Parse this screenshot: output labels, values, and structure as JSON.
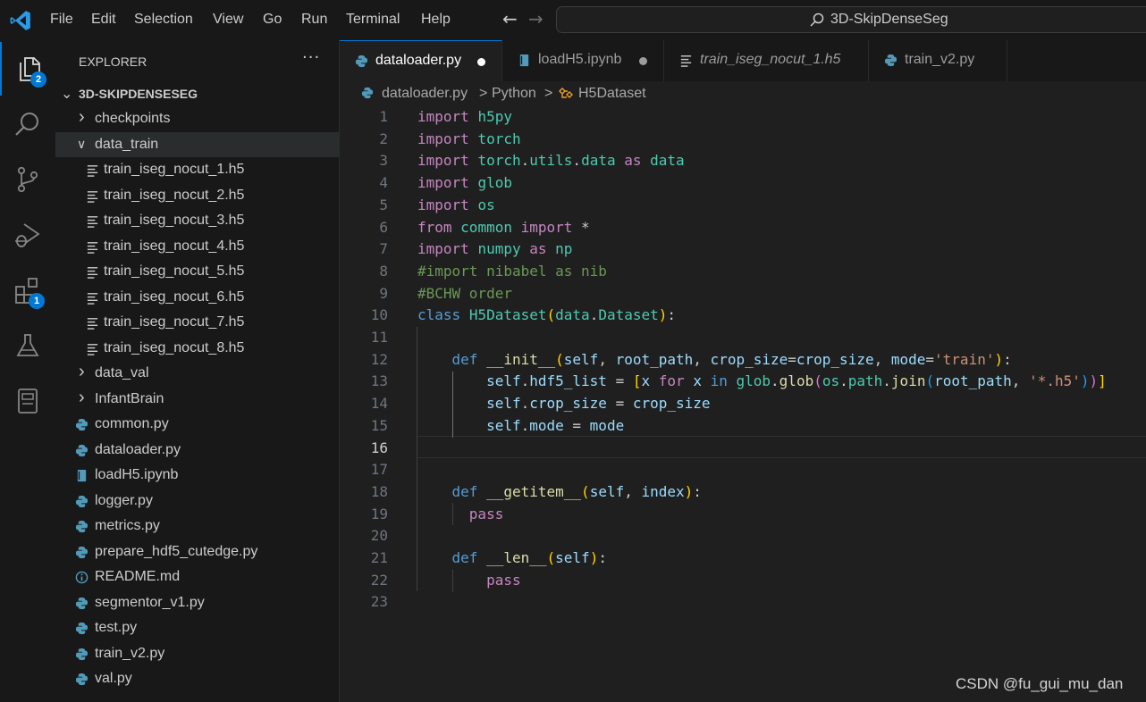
{
  "titlebar": {
    "menu": [
      "File",
      "Edit",
      "Selection",
      "View",
      "Go",
      "Run",
      "Terminal",
      "Help"
    ],
    "command_center": "3D-SkipDenseSeg"
  },
  "activity_bar": {
    "explorer_badge": "2",
    "extensions_badge": "1"
  },
  "sidebar": {
    "title": "EXPLORER",
    "more": "···",
    "workspace": "3D-SKIPDENSESEG",
    "tree": [
      {
        "label": "checkpoints",
        "kind": "folder",
        "expanded": false
      },
      {
        "label": "data_train",
        "kind": "folder",
        "expanded": true
      },
      {
        "label": "train_iseg_nocut_1.h5",
        "kind": "file-text"
      },
      {
        "label": "train_iseg_nocut_2.h5",
        "kind": "file-text"
      },
      {
        "label": "train_iseg_nocut_3.h5",
        "kind": "file-text"
      },
      {
        "label": "train_iseg_nocut_4.h5",
        "kind": "file-text"
      },
      {
        "label": "train_iseg_nocut_5.h5",
        "kind": "file-text"
      },
      {
        "label": "train_iseg_nocut_6.h5",
        "kind": "file-text"
      },
      {
        "label": "train_iseg_nocut_7.h5",
        "kind": "file-text"
      },
      {
        "label": "train_iseg_nocut_8.h5",
        "kind": "file-text"
      },
      {
        "label": "data_val",
        "kind": "folder",
        "expanded": false
      },
      {
        "label": "InfantBrain",
        "kind": "folder",
        "expanded": false
      },
      {
        "label": "common.py",
        "kind": "python"
      },
      {
        "label": "dataloader.py",
        "kind": "python"
      },
      {
        "label": "loadH5.ipynb",
        "kind": "notebook"
      },
      {
        "label": "logger.py",
        "kind": "python"
      },
      {
        "label": "metrics.py",
        "kind": "python"
      },
      {
        "label": "prepare_hdf5_cutedge.py",
        "kind": "python"
      },
      {
        "label": "README.md",
        "kind": "info"
      },
      {
        "label": "segmentor_v1.py",
        "kind": "python"
      },
      {
        "label": "test.py",
        "kind": "python"
      },
      {
        "label": "train_v2.py",
        "kind": "python"
      },
      {
        "label": "val.py",
        "kind": "python"
      }
    ]
  },
  "tabs": [
    {
      "label": "dataloader.py",
      "icon": "python",
      "active": true,
      "dirty": true
    },
    {
      "label": "loadH5.ipynb",
      "icon": "notebook",
      "active": false,
      "dirty": true
    },
    {
      "label": "train_iseg_nocut_1.h5",
      "icon": "file-text",
      "active": false,
      "dirty": false,
      "italic": true
    },
    {
      "label": "train_v2.py",
      "icon": "python",
      "active": false,
      "dirty": false
    }
  ],
  "breadcrumb": {
    "file": "dataloader.py",
    "sep1": ">",
    "language": "Python",
    "sep2": ">",
    "symbol": "H5Dataset"
  },
  "editor": {
    "current_line": 16,
    "lines": [
      [
        [
          "kw",
          "import"
        ],
        [
          "",
          " "
        ],
        [
          "mod",
          "h5py"
        ]
      ],
      [
        [
          "kw",
          "import"
        ],
        [
          "",
          " "
        ],
        [
          "mod",
          "torch"
        ]
      ],
      [
        [
          "kw",
          "import"
        ],
        [
          "",
          " "
        ],
        [
          "mod",
          "torch"
        ],
        [
          "",
          "."
        ],
        [
          "mod",
          "utils"
        ],
        [
          "",
          "."
        ],
        [
          "mod",
          "data"
        ],
        [
          "",
          " "
        ],
        [
          "kw",
          "as"
        ],
        [
          "",
          " "
        ],
        [
          "mod",
          "data"
        ]
      ],
      [
        [
          "kw",
          "import"
        ],
        [
          "",
          " "
        ],
        [
          "mod",
          "glob"
        ]
      ],
      [
        [
          "kw",
          "import"
        ],
        [
          "",
          " "
        ],
        [
          "mod",
          "os"
        ]
      ],
      [
        [
          "kw",
          "from"
        ],
        [
          "",
          " "
        ],
        [
          "mod",
          "common"
        ],
        [
          "",
          " "
        ],
        [
          "kw",
          "import"
        ],
        [
          "",
          " *"
        ]
      ],
      [
        [
          "kw",
          "import"
        ],
        [
          "",
          " "
        ],
        [
          "mod",
          "numpy"
        ],
        [
          "",
          " "
        ],
        [
          "kw",
          "as"
        ],
        [
          "",
          " "
        ],
        [
          "mod",
          "np"
        ]
      ],
      [
        [
          "com",
          "#import nibabel as nib"
        ]
      ],
      [
        [
          "com",
          "#BCHW order"
        ]
      ],
      [
        [
          "kw2",
          "class"
        ],
        [
          "",
          " "
        ],
        [
          "mod",
          "H5Dataset"
        ],
        [
          "br1",
          "("
        ],
        [
          "mod",
          "data"
        ],
        [
          "",
          "."
        ],
        [
          "mod",
          "Dataset"
        ],
        [
          "br1",
          ")"
        ],
        [
          "",
          ":"
        ]
      ],
      [],
      [
        [
          "",
          "    "
        ],
        [
          "kw2",
          "def"
        ],
        [
          "",
          " "
        ],
        [
          "fn",
          "__init__"
        ],
        [
          "br1",
          "("
        ],
        [
          "var",
          "self"
        ],
        [
          "",
          ", "
        ],
        [
          "var",
          "root_path"
        ],
        [
          "",
          ", "
        ],
        [
          "var",
          "crop_size"
        ],
        [
          "",
          "="
        ],
        [
          "var",
          "crop_size"
        ],
        [
          "",
          ", "
        ],
        [
          "var",
          "mode"
        ],
        [
          "",
          "="
        ],
        [
          "str",
          "'train'"
        ],
        [
          "br1",
          ")"
        ],
        [
          "",
          ":"
        ]
      ],
      [
        [
          "",
          "        "
        ],
        [
          "var",
          "self"
        ],
        [
          "",
          "."
        ],
        [
          "var",
          "hdf5_list"
        ],
        [
          "",
          " = "
        ],
        [
          "br1",
          "["
        ],
        [
          "var",
          "x"
        ],
        [
          "",
          " "
        ],
        [
          "kw",
          "for"
        ],
        [
          "",
          " "
        ],
        [
          "var",
          "x"
        ],
        [
          "",
          " "
        ],
        [
          "kw2",
          "in"
        ],
        [
          "",
          " "
        ],
        [
          "mod",
          "glob"
        ],
        [
          "",
          "."
        ],
        [
          "fn",
          "glob"
        ],
        [
          "br2",
          "("
        ],
        [
          "mod",
          "os"
        ],
        [
          "",
          "."
        ],
        [
          "mod",
          "path"
        ],
        [
          "",
          "."
        ],
        [
          "fn",
          "join"
        ],
        [
          "br3",
          "("
        ],
        [
          "var",
          "root_path"
        ],
        [
          "",
          ", "
        ],
        [
          "str",
          "'*.h5'"
        ],
        [
          "br3",
          ")"
        ],
        [
          "br2",
          ")"
        ],
        [
          "br1",
          "]"
        ]
      ],
      [
        [
          "",
          "        "
        ],
        [
          "var",
          "self"
        ],
        [
          "",
          "."
        ],
        [
          "var",
          "crop_size"
        ],
        [
          "",
          " = "
        ],
        [
          "var",
          "crop_size"
        ]
      ],
      [
        [
          "",
          "        "
        ],
        [
          "var",
          "self"
        ],
        [
          "",
          "."
        ],
        [
          "var",
          "mode"
        ],
        [
          "",
          " = "
        ],
        [
          "var",
          "mode"
        ]
      ],
      [],
      [],
      [
        [
          "",
          "    "
        ],
        [
          "kw2",
          "def"
        ],
        [
          "",
          " "
        ],
        [
          "fn",
          "__getitem__"
        ],
        [
          "br1",
          "("
        ],
        [
          "var",
          "self"
        ],
        [
          "",
          ", "
        ],
        [
          "var",
          "index"
        ],
        [
          "br1",
          ")"
        ],
        [
          "",
          ":"
        ]
      ],
      [
        [
          "",
          "      "
        ],
        [
          "kw",
          "pass"
        ]
      ],
      [],
      [
        [
          "",
          "    "
        ],
        [
          "kw2",
          "def"
        ],
        [
          "",
          " "
        ],
        [
          "fn",
          "__len__"
        ],
        [
          "br1",
          "("
        ],
        [
          "var",
          "self"
        ],
        [
          "br1",
          ")"
        ],
        [
          "",
          ":"
        ]
      ],
      [
        [
          "",
          "        "
        ],
        [
          "kw",
          "pass"
        ]
      ],
      []
    ]
  },
  "watermark": "CSDN @fu_gui_mu_dan",
  "colors": {
    "accent": "#0078d4",
    "background": "#1f1f1f",
    "sidebar": "#181818",
    "python_icon": "#519aba",
    "dirty_dot": "#ffffff"
  }
}
